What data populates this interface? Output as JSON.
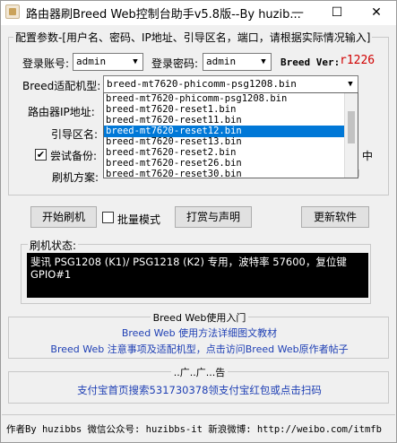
{
  "window": {
    "title": "路由器刷Breed Web控制台助手v5.8版--By huzib...",
    "minimize": "—",
    "maximize": "☐",
    "close": "✕"
  },
  "config": {
    "group_label": "配置参数-[用户名、密码、IP地址、引导区名，端口，请根据实际情况输入]",
    "username_label": "登录账号:",
    "username_value": "admin",
    "password_label": "登录密码:",
    "password_value": "admin",
    "breed_ver_label": "Breed Ver:",
    "breed_ver_value": "r1226",
    "model_label": "Breed适配机型:",
    "model_value": "breed-mt7620-phicomm-psg1208.bin",
    "router_ip_label": "路由器IP地址:",
    "boot_label": "引导区名:",
    "backup_label": "尝试备份:",
    "backup_checked": "✔",
    "backup_tail": "中",
    "flash_plan_label": "刷机方案:",
    "dropdown_items": [
      "breed-mt7620-phicomm-psg1208.bin",
      "breed-mt7620-reset1.bin",
      "breed-mt7620-reset11.bin",
      "breed-mt7620-reset12.bin",
      "breed-mt7620-reset13.bin",
      "breed-mt7620-reset2.bin",
      "breed-mt7620-reset26.bin",
      "breed-mt7620-reset30.bin"
    ]
  },
  "actions": {
    "start_flash": "开始刷机",
    "batch_mode": "批量模式",
    "donate": "打赏与声明",
    "update": "更新软件"
  },
  "status": {
    "group_label": "刷机状态:",
    "line1": "斐讯 PSG1208 (K1)/ PSG1218 (K2) 专用，波特率 57600，复位键",
    "line2": "GPIO#1"
  },
  "intro": {
    "group_label": "Breed Web使用入门",
    "link1": "Breed Web 使用方法详细图文教材",
    "link2": "Breed Web 注意事项及适配机型，点击访问Breed Web原作者帖子"
  },
  "ad": {
    "group_label": "..广..广...告",
    "link": "支付宝首页搜索531730378领支付宝红包或点击扫码"
  },
  "footer": {
    "text": "作者By huzibbs 微信公众号: huzibbs-it 新浪微博: http://weibo.com/itmfb"
  }
}
